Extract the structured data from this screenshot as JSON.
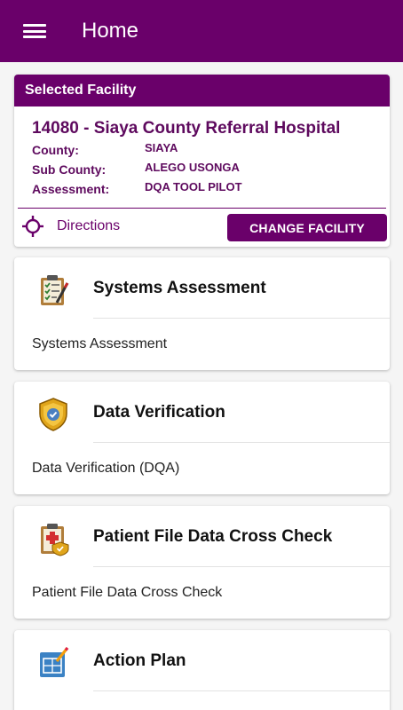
{
  "appbar": {
    "title": "Home",
    "menu_icon": "hamburger-menu-icon"
  },
  "facility": {
    "header": "Selected Facility",
    "name": "14080 - Siaya County Referral Hospital",
    "county_label": "County:",
    "county_value": "SIAYA",
    "subcounty_label": "Sub County:",
    "subcounty_value": "ALEGO USONGA",
    "assessment_label": "Assessment:",
    "assessment_value": "DQA TOOL PILOT",
    "directions_label": "Directions",
    "change_button": "CHANGE FACILITY"
  },
  "cards": [
    {
      "title": "Systems Assessment",
      "subtitle": "Systems Assessment",
      "icon": "clipboard-checklist-icon"
    },
    {
      "title": "Data Verification",
      "subtitle": "Data Verification (DQA)",
      "icon": "shield-check-icon"
    },
    {
      "title": "Patient File Data Cross Check",
      "subtitle": "Patient File Data Cross Check",
      "icon": "medical-clipboard-icon"
    },
    {
      "title": "Action Plan",
      "subtitle": "",
      "icon": "plan-edit-icon"
    }
  ],
  "colors": {
    "primary": "#6a006a",
    "background": "#f5f5f5"
  }
}
